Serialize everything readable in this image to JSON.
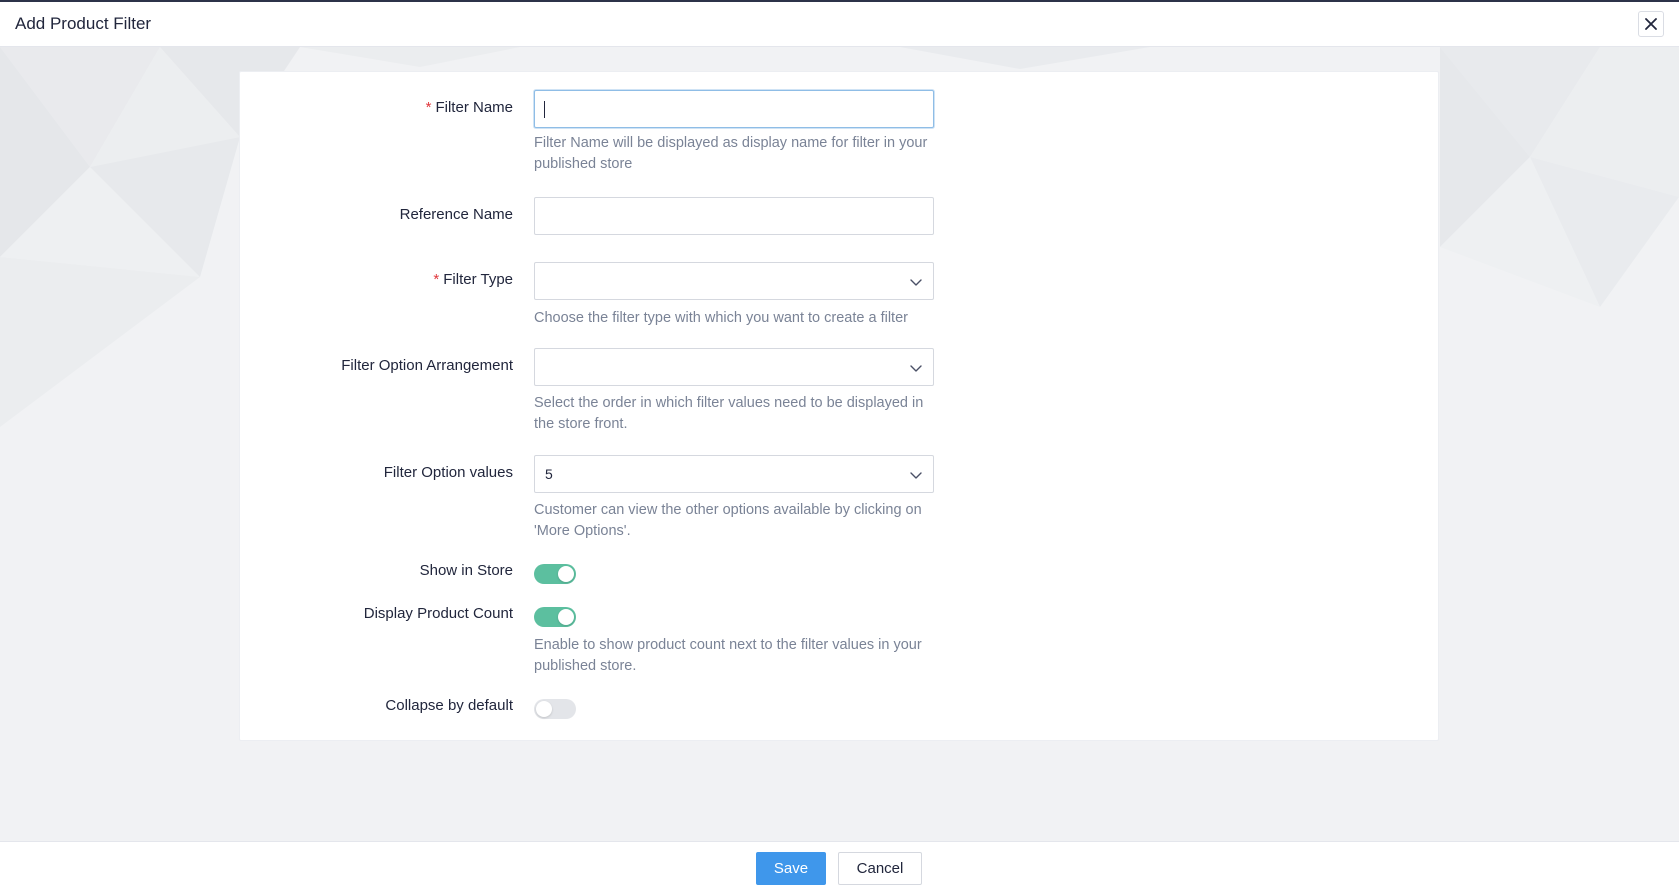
{
  "header": {
    "title": "Add Product Filter",
    "close_icon": "close-icon"
  },
  "form": {
    "filter_name": {
      "label": "Filter Name",
      "required_mark": "*",
      "value": "",
      "help": "Filter Name will be displayed as display name for filter in your published store"
    },
    "reference_name": {
      "label": "Reference Name",
      "value": ""
    },
    "filter_type": {
      "label": "Filter Type",
      "required_mark": "*",
      "value": "",
      "help": "Choose the filter type with which you want to create a filter"
    },
    "filter_option_arrangement": {
      "label": "Filter Option Arrangement",
      "value": "",
      "help": "Select the order in which filter values need to be displayed in the store front."
    },
    "filter_option_values": {
      "label": "Filter Option values",
      "value": "5",
      "help": "Customer can view the other options available by clicking on 'More Options'."
    },
    "show_in_store": {
      "label": "Show in Store",
      "enabled": true
    },
    "display_product_count": {
      "label": "Display Product Count",
      "enabled": true,
      "help": "Enable to show product count next to the filter values in your published store."
    },
    "collapse_by_default": {
      "label": "Collapse by default",
      "enabled": false
    }
  },
  "footer": {
    "save_label": "Save",
    "cancel_label": "Cancel"
  },
  "colors": {
    "primary": "#3f97eb",
    "toggle_on": "#5cbf9f",
    "toggle_off": "#e3e5e9",
    "required": "#e0373c",
    "help_text": "#7a8396"
  }
}
